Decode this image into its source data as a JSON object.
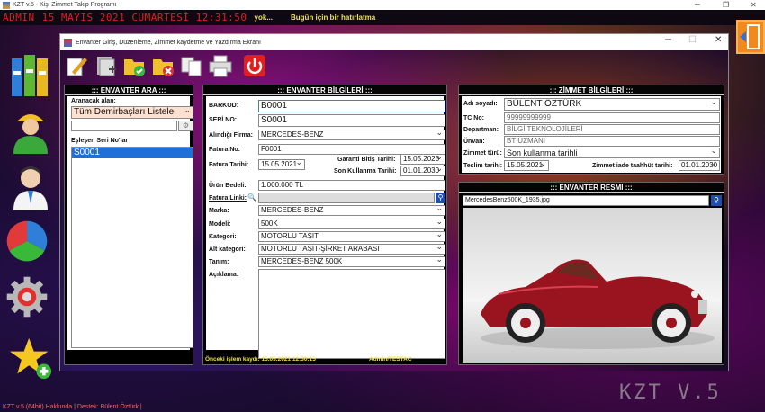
{
  "app_title": "KZT v.5 - Kişi Zimmet Takip Programı",
  "os_controls": {
    "minimize": "─",
    "maximize": "❐",
    "close": "✕"
  },
  "ticker": {
    "user": "ADMIN",
    "datetime": "15 MAYIS 2021 CUMARTESİ 12:31:50",
    "greeting": "yok...",
    "message": "Bugün için bir hatırlatma"
  },
  "window": {
    "title": "Envanter Giriş, Düzenleme, Zimmet kaydetme ve Yazdırma Ekranı",
    "controls": {
      "minimize": "─",
      "maximize": "☐",
      "close": "✕"
    }
  },
  "search_panel": {
    "header": "::: ENVANTER ARA :::",
    "search_label": "Aranacak alan:",
    "search_field": "Tüm Demirbaşları Listele",
    "search_text": "",
    "matches_label": "Eşleşen Seri No'lar",
    "matches": [
      "S0001"
    ]
  },
  "inventory_panel": {
    "header": "::: ENVANTER BİLGİLERİ :::",
    "barcode_label": "BARKOD:",
    "barcode": "B0001",
    "serial_label": "SERİ NO:",
    "serial": "S0001",
    "supplier_label": "Alındığı Firma:",
    "supplier": "MERCEDES-BENZ",
    "invoice_no_label": "Fatura No:",
    "invoice_no": "F0001",
    "invoice_date_label": "Fatura Tarihi:",
    "invoice_date": "15.05.2021",
    "warranty_end_label": "Garanti Bitiş Tarihi:",
    "warranty_end": "15.05.2023",
    "last_use_label": "Son Kullanma Tarihi:",
    "last_use": "01.01.2030",
    "price_label": "Ürün Bedeli:",
    "price": "1.000.000 TL",
    "invoice_link_label": "Fatura Linki:",
    "invoice_link": "",
    "brand_label": "Marka:",
    "brand": "MERCEDES-BENZ",
    "model_label": "Modeli:",
    "model": "500K",
    "category_label": "Kategori:",
    "category": "MOTORLU TAŞIT",
    "subcategory_label": "Alt kategori:",
    "subcategory": "MOTORLU TAŞIT-ŞİRKET ARABASI",
    "definition_label": "Tanım:",
    "definition": "MERCEDES-BENZ 500K",
    "description_label": "Açıklama:",
    "description": "",
    "last_action": "Önceki işlem kaydı:  15.05.2021 12:30:15",
    "last_user": "Admin/TESTAC"
  },
  "assignment_panel": {
    "header": "::: ZİMMET BİLGİLERİ :::",
    "name_label": "Adı soyadı:",
    "name": "BÜLENT ÖZTÜRK",
    "tc_label": "TC No:",
    "tc": "99999999999",
    "department_label": "Departman:",
    "department": "BİLGİ TEKNOLOJİLERİ",
    "title_label": "Ünvan:",
    "title": "BT UZMANI",
    "type_label": "Zimmet türü:",
    "type": "Son kullanma tarihli",
    "delivery_date_label": "Teslim tarihi:",
    "delivery_date": "15.05.2021",
    "return_date_label": "Zimmet iade taahhüt tarihi:",
    "return_date": "01.01.2030"
  },
  "image_panel": {
    "header": "::: ENVANTER RESMİ :::",
    "filename": "MercedesBenz500K_1935.jpg"
  },
  "footer": {
    "about": "KZT v.5 (64bit) Hakkında  |",
    "support": "Destek: Bülent Öztürk  |"
  },
  "brand": "KZT V.5"
}
